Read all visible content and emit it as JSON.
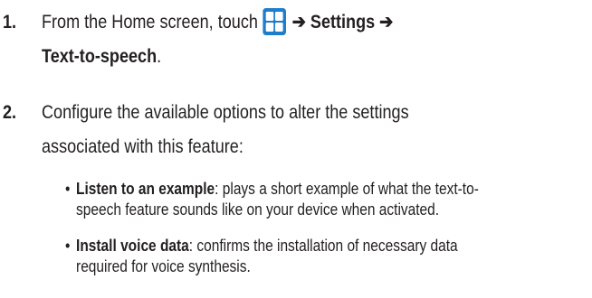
{
  "steps": [
    {
      "number": "1.",
      "line1_prefix": "From the Home screen, touch",
      "arrow1": "➔",
      "settings": "Settings",
      "arrow2": "➔",
      "line2_bold": "Text-to-speech",
      "line2_end": "."
    },
    {
      "number": "2.",
      "line1": "Configure the available options to alter the settings",
      "line2": "associated with this feature:"
    }
  ],
  "bullets": [
    {
      "mark": "•",
      "term": "Listen to an example",
      "desc_line1": ": plays a short example of what the text-to-",
      "desc_line2": "speech feature sounds like on your device when activated."
    },
    {
      "mark": "•",
      "term": "Install voice data",
      "desc_line1": ": confirms the installation of necessary data",
      "desc_line2": "required for voice synthesis."
    }
  ],
  "icons": {
    "apps": "apps-grid-icon"
  },
  "colors": {
    "text": "#231f20",
    "icon_bg": "#1f7ecb",
    "icon_tile": "#ffffff"
  }
}
